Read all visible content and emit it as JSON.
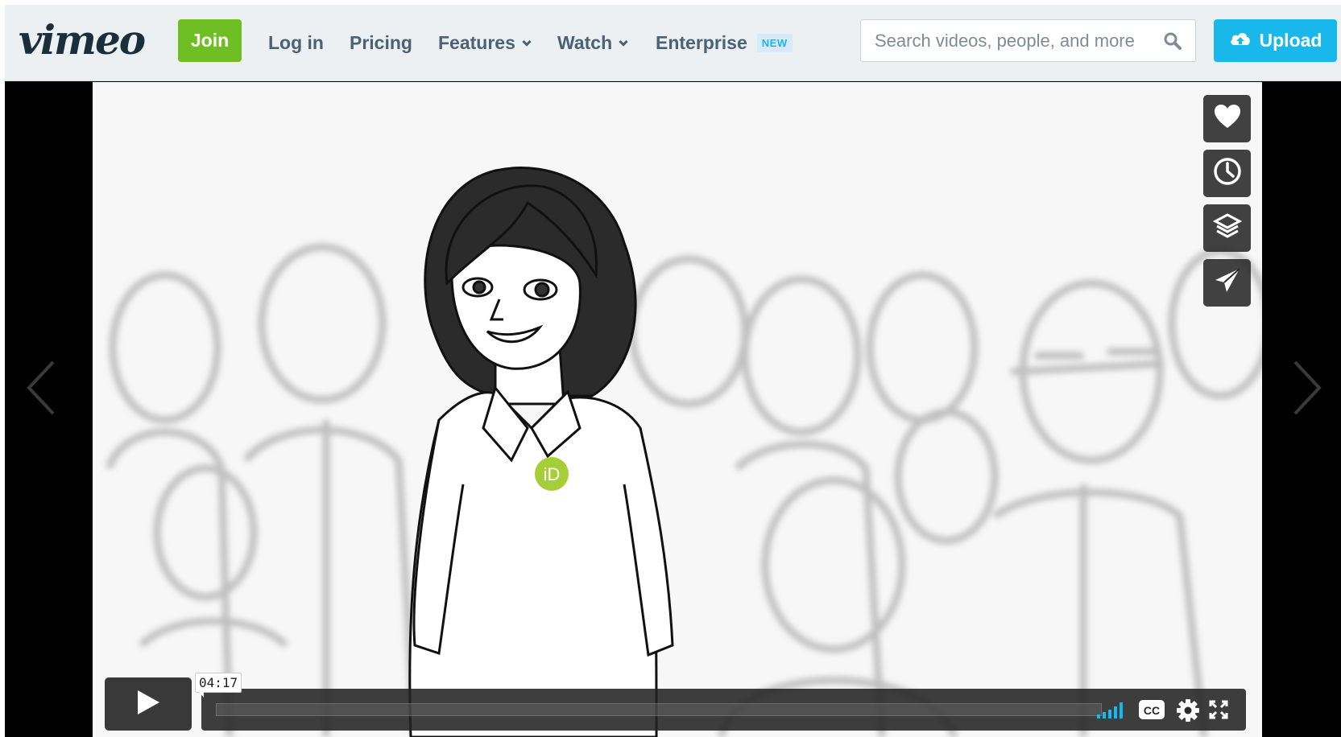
{
  "header": {
    "logo": "vimeo",
    "join_label": "Join",
    "nav": {
      "login": "Log in",
      "pricing": "Pricing",
      "features": "Features",
      "watch": "Watch",
      "enterprise": "Enterprise",
      "enterprise_badge": "NEW"
    },
    "search_placeholder": "Search videos, people, and more",
    "upload_label": "Upload"
  },
  "player": {
    "time_tooltip": "04:17",
    "progress_fraction": 0,
    "action_icons": [
      "heart-icon",
      "clock-icon",
      "layers-icon",
      "paper-plane-icon"
    ],
    "control_icons": [
      "volume-bars-icon",
      "cc-icon",
      "gear-icon",
      "fullscreen-icon"
    ],
    "badge_text": "iD"
  },
  "colors": {
    "join_green": "#6fbe23",
    "upload_blue": "#1ab7ea",
    "header_bg": "#ecf0f2",
    "nav_text": "#4a6274",
    "orcid_green": "#a6ce39"
  }
}
